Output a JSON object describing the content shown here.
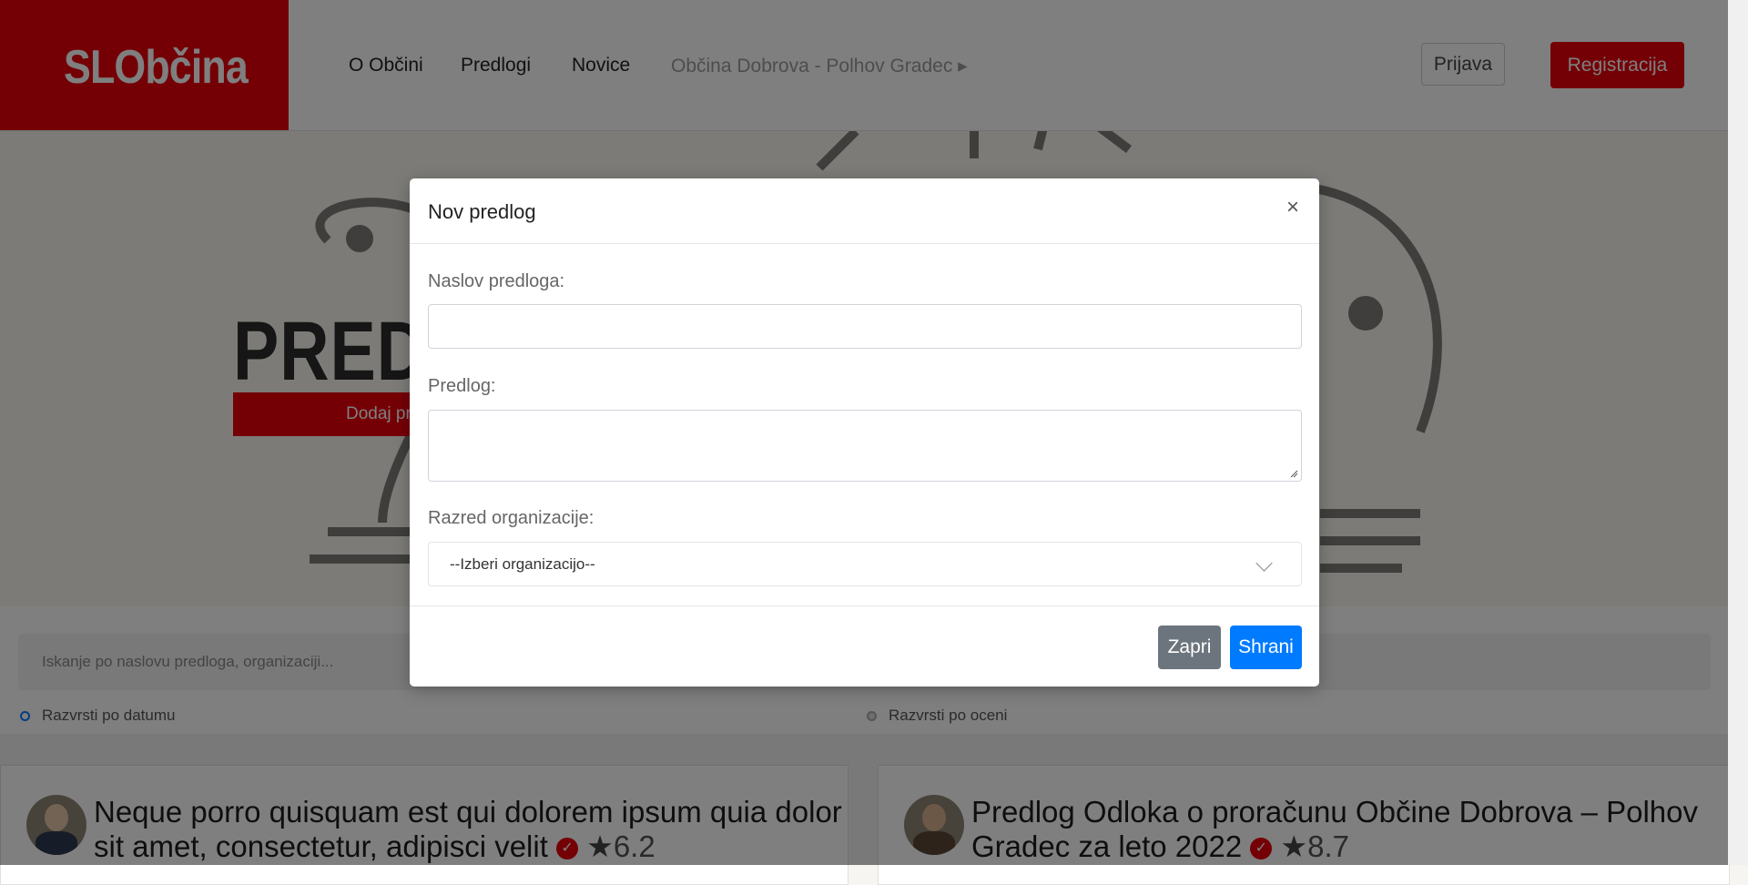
{
  "navbar": {
    "logo": "SLObčina",
    "links": [
      "O Občini",
      "Predlogi",
      "Novice"
    ],
    "municipality_menu": "Občina Dobrova - Polhov Gradec ▸",
    "login": "Prijava",
    "register": "Registracija"
  },
  "hero": {
    "title": "PREDL",
    "button": "Dodaj pre"
  },
  "search": {
    "placeholder": "Iskanje po naslovu predloga, organizaciji...",
    "sort_date": "Razvrsti po datumu",
    "sort_rating": "Razvrsti po oceni"
  },
  "cards": [
    {
      "title": "Neque porro quisquam est qui dolorem ipsum quia dolor sit amet, consectetur, adipisci velit",
      "verified": "✓",
      "star": "★",
      "score": "6.2"
    },
    {
      "title": "Predlog Odloka o proračunu Občine Dobrova – Polhov Gradec za leto 2022",
      "verified": "✓",
      "star": "★",
      "score": "8.7"
    }
  ],
  "modal": {
    "title": "Nov predlog",
    "close_icon": "×",
    "title_label": "Naslov predloga:",
    "title_value": "",
    "proposal_label": "Predlog:",
    "proposal_value": "",
    "org_label": "Razred organizacije:",
    "org_selected": "--Izberi organizacijo--",
    "btn_close": "Zapri",
    "btn_save": "Shrani"
  },
  "colors": {
    "brand_red": "#e8000d",
    "primary_blue": "#007bff",
    "secondary_gray": "#6c757d"
  }
}
